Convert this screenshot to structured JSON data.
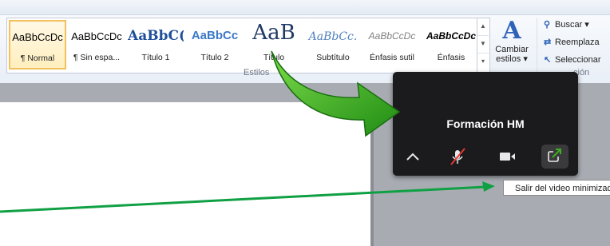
{
  "styles_gallery": {
    "tiles": [
      {
        "preview": "AaBbCcDc",
        "label": "¶ Normal"
      },
      {
        "preview": "AaBbCcDc",
        "label": "¶ Sin espa..."
      },
      {
        "preview": "AaBbC(",
        "label": "Título 1"
      },
      {
        "preview": "AaBbCc",
        "label": "Título 2"
      },
      {
        "preview": "AaB",
        "label": "Título"
      },
      {
        "preview": "AaBbCc.",
        "label": "Subtítulo"
      },
      {
        "preview": "AaBbCcDc",
        "label": "Énfasis sutil"
      },
      {
        "preview": "AaBbCcDc",
        "label": "Énfasis"
      }
    ],
    "group_label": "Estilos",
    "selected_index": 0
  },
  "change_styles": {
    "line1": "Cambiar",
    "line2": "estilos ▾",
    "icon": "change-styles-icon"
  },
  "editing": {
    "find_label": "Buscar ▾",
    "replace_label": "Reemplaza",
    "select_label": "Seleccionar",
    "group_label": "ción"
  },
  "zoom_panel": {
    "meeting_name": "Formación HM",
    "buttons": [
      "chevron-up-icon",
      "microphone-muted-icon",
      "video-camera-icon",
      "exit-minimized-video-icon"
    ]
  },
  "tooltip": {
    "text": "Salir del video minimizado"
  },
  "colors": {
    "accent_green": "#3cae1f",
    "line_green": "#10a044",
    "panel_bg": "#1b1b1d",
    "mute_red": "#e53935"
  }
}
